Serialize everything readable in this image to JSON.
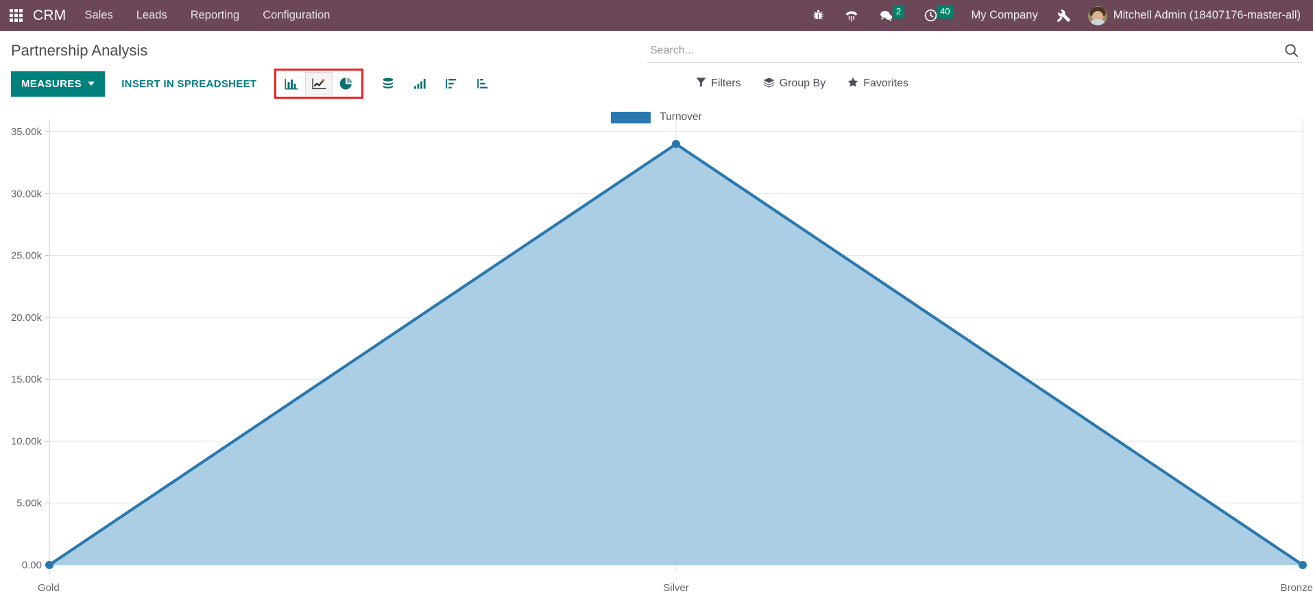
{
  "navbar": {
    "apps_icon": "apps-grid-icon",
    "brand": "CRM",
    "menu": [
      {
        "label": "Sales"
      },
      {
        "label": "Leads"
      },
      {
        "label": "Reporting"
      },
      {
        "label": "Configuration"
      }
    ],
    "system_icons": [
      {
        "name": "bug-icon",
        "badge": null
      },
      {
        "name": "phone-keypad-icon",
        "badge": null
      },
      {
        "name": "messages-icon",
        "badge": "2"
      },
      {
        "name": "activities-clock-icon",
        "badge": "40"
      }
    ],
    "company": "My Company",
    "tools_icon": "tools-wrench-icon",
    "user": "Mitchell Admin (18407176-master-all)"
  },
  "control_panel": {
    "title": "Partnership Analysis",
    "search": {
      "placeholder": "Search...",
      "value": ""
    },
    "search_icon": "search-icon",
    "measures_label": "MEASURES",
    "spreadsheet_label": "INSERT IN SPREADSHEET",
    "chart_types": [
      {
        "name": "bar-chart-icon",
        "label": "Bar Chart",
        "active": false
      },
      {
        "name": "line-chart-icon",
        "label": "Line Chart",
        "active": true
      },
      {
        "name": "pie-chart-icon",
        "label": "Pie Chart",
        "active": false
      }
    ],
    "tools": [
      {
        "name": "stacked-database-icon",
        "label": "Stacked"
      },
      {
        "name": "ascending-bars-icon",
        "label": "Cumulative"
      },
      {
        "name": "sort-descending-icon",
        "label": "Descending"
      },
      {
        "name": "sort-ascending-icon",
        "label": "Ascending"
      }
    ],
    "filters": [
      {
        "name": "filters",
        "icon": "funnel-icon",
        "label": "Filters"
      },
      {
        "name": "group-by",
        "icon": "layers-icon",
        "label": "Group By"
      },
      {
        "name": "favorites",
        "icon": "star-icon",
        "label": "Favorites"
      }
    ],
    "highlight_color": "#ee2222",
    "accent_color": "#00807d"
  },
  "chart_data": {
    "type": "area",
    "title": "",
    "xlabel": "",
    "ylabel": "",
    "categories": [
      "Gold",
      "Silver",
      "Bronze"
    ],
    "series": [
      {
        "name": "Turnover",
        "values": [
          0,
          34000,
          0
        ],
        "color": "#2979b0",
        "fill": "#a6cbe3"
      }
    ],
    "ylim": [
      0,
      35000
    ],
    "ytick_labels": [
      "35.00k",
      "30.00k",
      "25.00k",
      "20.00k",
      "15.00k",
      "10.00k",
      "5.00k",
      "0.00"
    ],
    "ytick_values": [
      35000,
      30000,
      25000,
      20000,
      15000,
      10000,
      5000,
      0
    ],
    "grid": true,
    "legend": {
      "position": "top",
      "entries": [
        "Turnover"
      ]
    }
  }
}
